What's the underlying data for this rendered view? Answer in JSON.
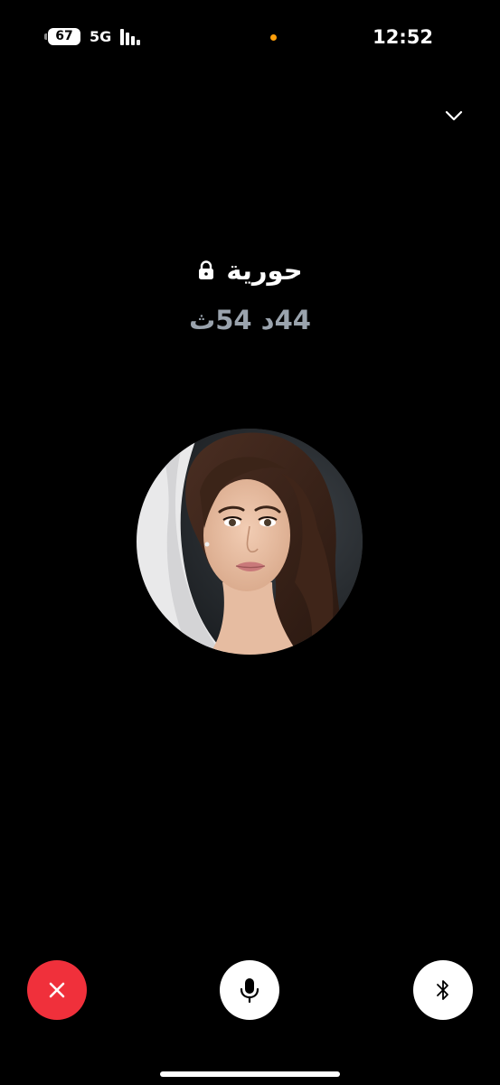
{
  "status_bar": {
    "battery_level": "67",
    "network": "5G",
    "time": "12:52",
    "privacy_dot_color": "#ff9f0a"
  },
  "call": {
    "caller_name": "حورية",
    "duration": "44د 54ث",
    "encrypted": true
  },
  "controls": {
    "end_call_color": "#f0303b",
    "button_color": "#ffffff",
    "items": [
      {
        "name": "end-call",
        "icon": "close-icon"
      },
      {
        "name": "mute",
        "icon": "microphone-icon"
      },
      {
        "name": "bluetooth",
        "icon": "bluetooth-icon"
      }
    ]
  },
  "icons": {
    "minimize": "chevron-down-icon",
    "lock": "lock-icon",
    "avatar": "profile-photo"
  }
}
